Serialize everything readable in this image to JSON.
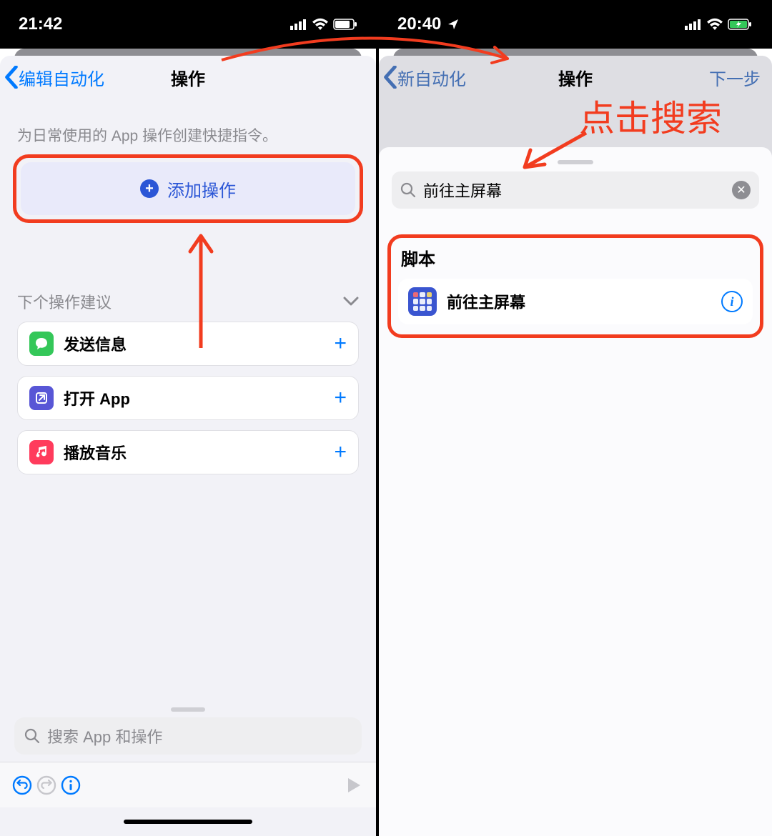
{
  "left": {
    "status_time": "21:42",
    "nav_back": "编辑自动化",
    "nav_title": "操作",
    "hint": "为日常使用的 App 操作创建快捷指令。",
    "add_action": "添加操作",
    "section_header": "下个操作建议",
    "suggestions": [
      {
        "label": "发送信息",
        "icon": "messages"
      },
      {
        "label": "打开 App",
        "icon": "open-app"
      },
      {
        "label": "播放音乐",
        "icon": "music"
      }
    ],
    "search_placeholder": "搜索 App 和操作"
  },
  "right": {
    "status_time": "20:40",
    "nav_back": "新自动化",
    "nav_title": "操作",
    "nav_next": "下一步",
    "search_value": "前往主屏幕",
    "result_section": "脚本",
    "result_item": "前往主屏幕"
  },
  "annotation": {
    "click_search": "点击搜索"
  }
}
